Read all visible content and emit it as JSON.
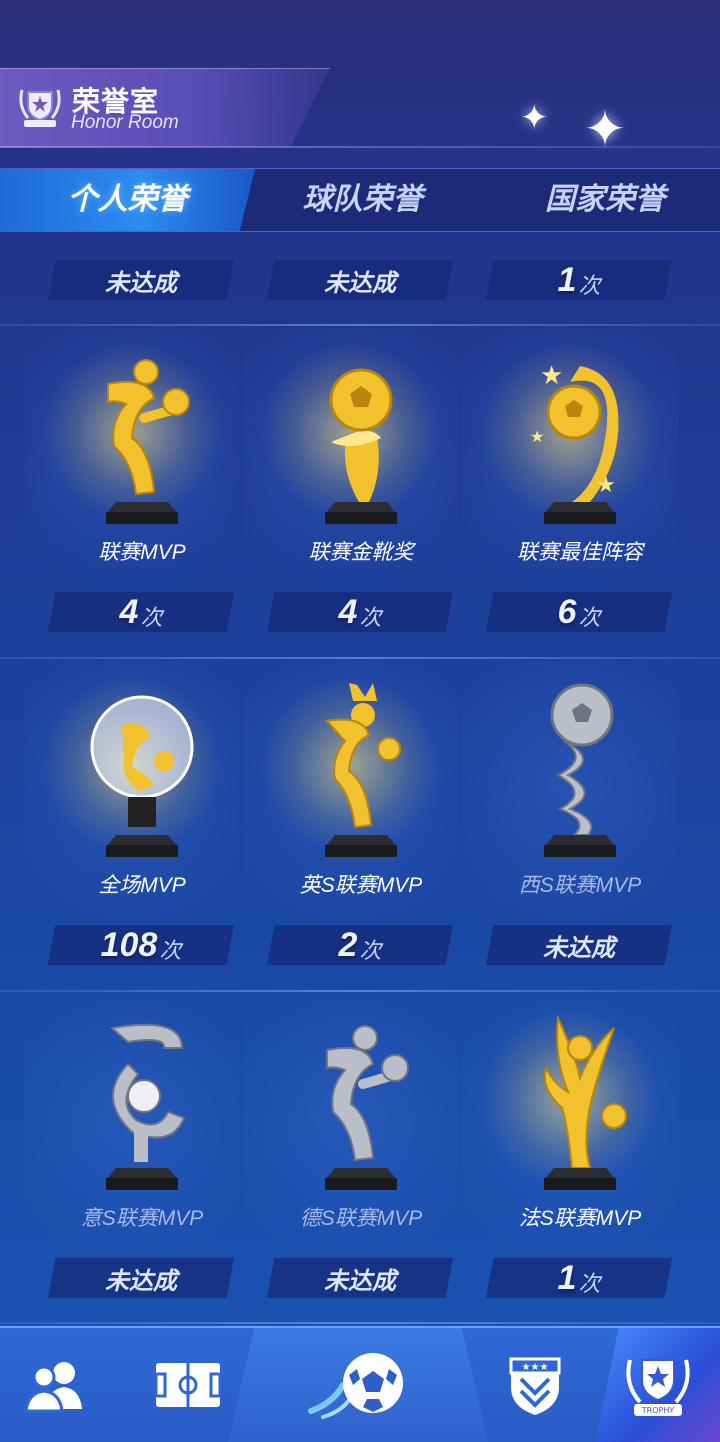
{
  "header": {
    "title": "荣誉室",
    "subtitle": "Honor Room"
  },
  "tabs": [
    {
      "label": "个人荣誉",
      "active": true
    },
    {
      "label": "球队荣誉",
      "active": false
    },
    {
      "label": "国家荣誉",
      "active": false
    }
  ],
  "top_counts": [
    {
      "text": "未达成"
    },
    {
      "text": "未达成"
    },
    {
      "num": "1",
      "unit": "次"
    }
  ],
  "trophies": [
    {
      "name": "联赛MVP",
      "num": "4",
      "unit": "次",
      "achieved": true,
      "icon": "league-mvp-trophy"
    },
    {
      "name": "联赛金靴奖",
      "num": "4",
      "unit": "次",
      "achieved": true,
      "icon": "golden-boot-trophy"
    },
    {
      "name": "联赛最佳阵容",
      "num": "6",
      "unit": "次",
      "achieved": true,
      "icon": "best-lineup-trophy"
    },
    {
      "name": "全场MVP",
      "num": "108",
      "unit": "次",
      "achieved": true,
      "icon": "match-mvp-trophy"
    },
    {
      "name": "英S联赛MVP",
      "num": "2",
      "unit": "次",
      "achieved": true,
      "icon": "premier-league-mvp-trophy"
    },
    {
      "name": "西S联赛MVP",
      "text": "未达成",
      "achieved": false,
      "icon": "la-liga-mvp-trophy"
    },
    {
      "name": "意S联赛MVP",
      "text": "未达成",
      "achieved": false,
      "icon": "serie-a-mvp-trophy"
    },
    {
      "name": "德S联赛MVP",
      "text": "未达成",
      "achieved": false,
      "icon": "bundesliga-mvp-trophy"
    },
    {
      "name": "法S联赛MVP",
      "num": "1",
      "unit": "次",
      "achieved": true,
      "icon": "ligue1-mvp-trophy"
    }
  ],
  "bottom_nav": [
    {
      "icon": "players-icon",
      "active": false
    },
    {
      "icon": "pitch-icon",
      "active": false
    },
    {
      "icon": "soccer-ball-icon",
      "active": false
    },
    {
      "icon": "club-badge-icon",
      "active": false
    },
    {
      "icon": "trophy-badge-icon",
      "active": true,
      "badge_text": "TROPHY"
    }
  ],
  "colors": {
    "gold": "#f2c12e",
    "silver": "#b9bec9",
    "accent": "#2c8cf0"
  }
}
